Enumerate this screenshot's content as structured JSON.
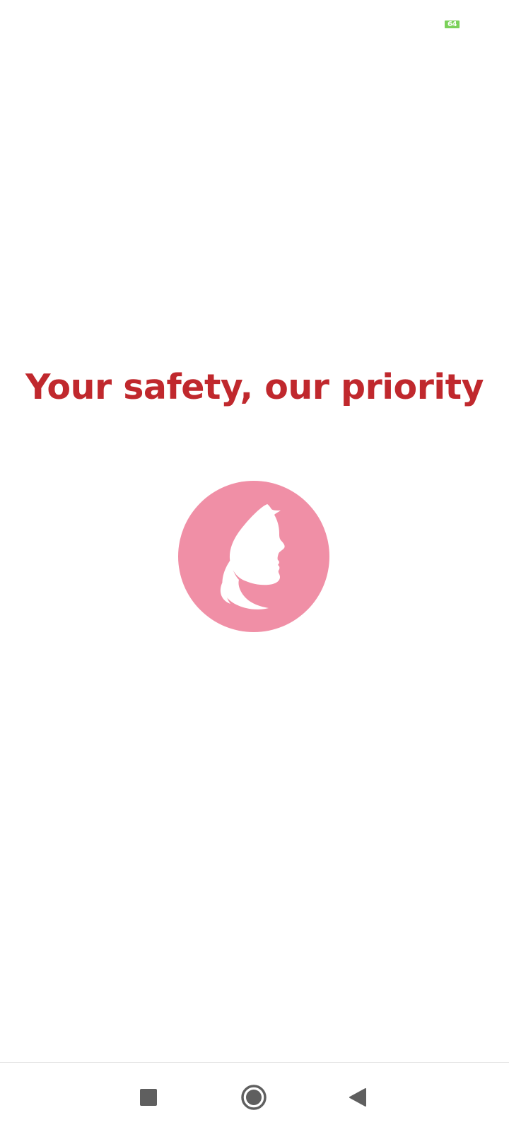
{
  "status_bar": {
    "battery_level": "64",
    "battery_color": "#7bd15a"
  },
  "splash": {
    "tagline": "Your safety, our priority",
    "tagline_color": "#c0282d",
    "logo": {
      "icon": "woman-profile-icon",
      "circle_color": "#f08fa6",
      "silhouette_color": "#ffffff"
    }
  },
  "navigation_bar": {
    "buttons": [
      {
        "name": "recents-button",
        "icon": "square-icon"
      },
      {
        "name": "home-button",
        "icon": "circle-icon"
      },
      {
        "name": "back-button",
        "icon": "triangle-back-icon"
      }
    ],
    "icon_color": "#5f5f5f"
  }
}
